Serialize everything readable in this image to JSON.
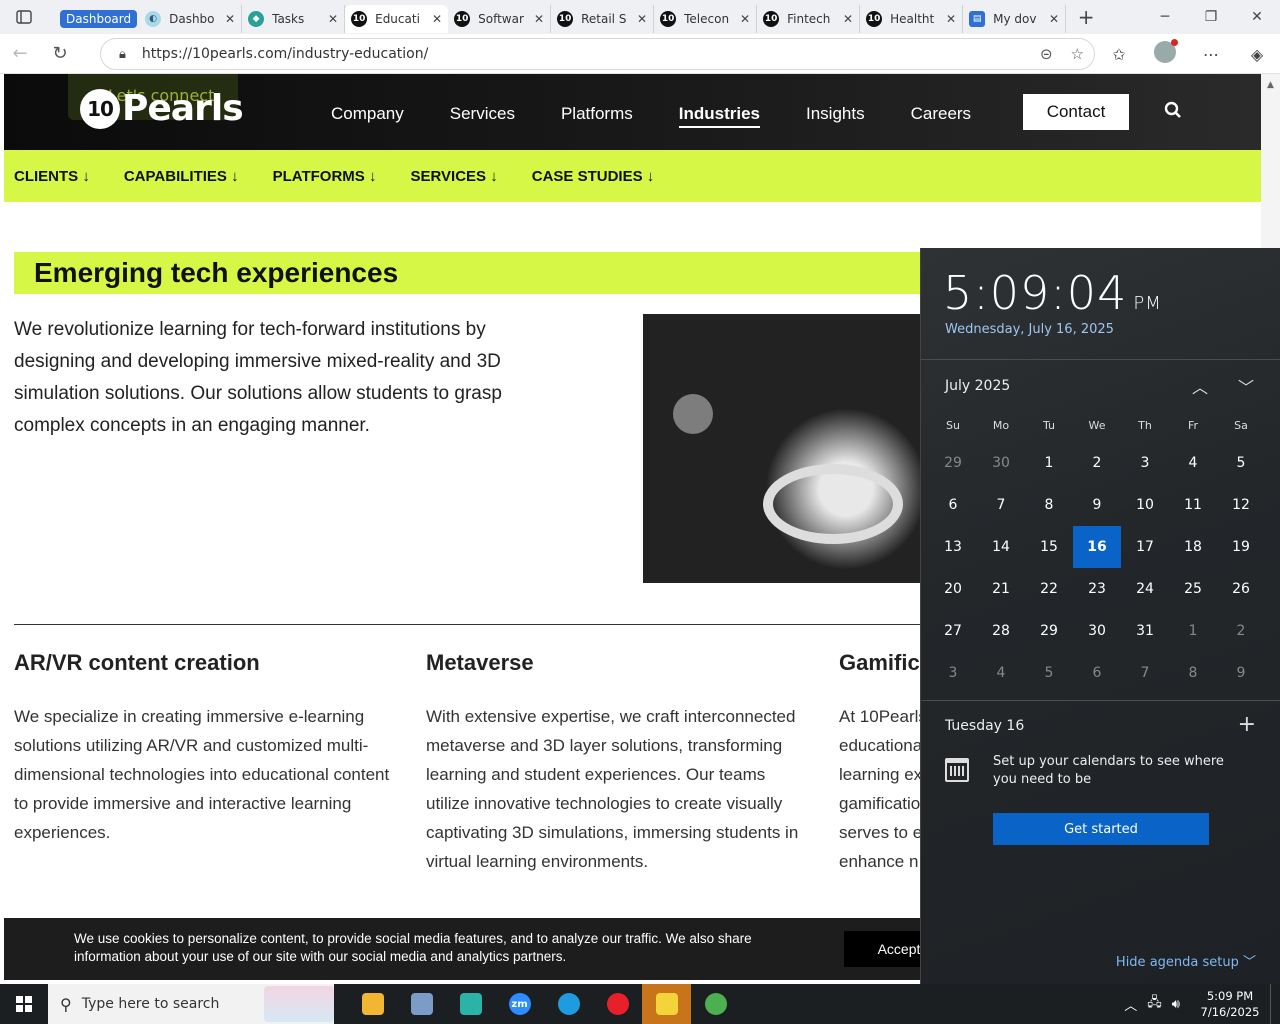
{
  "browser": {
    "group_label": "Dashboard",
    "tabs": [
      {
        "title": "Dashbo",
        "icon": "dashboard-favicon"
      },
      {
        "title": "Tasks",
        "icon": "tasks-favicon"
      },
      {
        "title": "Educati",
        "icon": "10pearls-favicon",
        "active": true
      },
      {
        "title": "Softwar",
        "icon": "10pearls-favicon"
      },
      {
        "title": "Retail S",
        "icon": "10pearls-favicon"
      },
      {
        "title": "Telecon",
        "icon": "10pearls-favicon"
      },
      {
        "title": "Fintech",
        "icon": "10pearls-favicon"
      },
      {
        "title": "Healtht",
        "icon": "10pearls-favicon"
      },
      {
        "title": "My dov",
        "icon": "docs-favicon"
      }
    ],
    "url": "https://10pearls.com/industry-education/"
  },
  "site": {
    "lets_connect": "Let's connect",
    "logo": "Pearls",
    "logo_mark": "10",
    "nav": [
      "Company",
      "Services",
      "Platforms",
      "Industries",
      "Insights",
      "Careers"
    ],
    "nav_active": "Industries",
    "contact": "Contact",
    "subnav": [
      "CLIENTS ↓",
      "CAPABILITIES ↓",
      "PLATFORMS ↓",
      "SERVICES ↓",
      "CASE STUDIES ↓"
    ],
    "section_title": "Emerging tech experiences",
    "intro": "We revolutionize learning for tech-forward institutions by designing and developing immersive mixed-reality and 3D simulation solutions. Our solutions allow students to grasp complex concepts in an engaging manner.",
    "columns": [
      {
        "title": "AR/VR content creation",
        "text": "We specialize in creating immersive e-learning solutions utilizing AR/VR and customized multi-dimensional technologies into educational content to provide immersive and interactive learning experiences."
      },
      {
        "title": "Metaverse",
        "text": "With extensive expertise, we craft interconnected metaverse and 3D layer solutions, transforming learning and student experiences. Our teams utilize innovative technologies to create visually captivating 3D simulations, immersing students in virtual learning environments."
      },
      {
        "title": "Gamific",
        "text": "At 10Pearls educationa learning ex gamificatio serves to e enhance n"
      }
    ],
    "cookie_text": "We use cookies to personalize content, to provide social media features, and to analyze our traffic. We also share information about your use of our site with our social media and analytics partners.",
    "cookie_accept": "Accept"
  },
  "calendar": {
    "time": "5:09:04",
    "ampm": "PM",
    "date": "Wednesday, July 16, 2025",
    "month": "July 2025",
    "weekdays": [
      "Su",
      "Mo",
      "Tu",
      "We",
      "Th",
      "Fr",
      "Sa"
    ],
    "days": [
      {
        "d": "29",
        "dim": true
      },
      {
        "d": "30",
        "dim": true
      },
      {
        "d": "1"
      },
      {
        "d": "2"
      },
      {
        "d": "3"
      },
      {
        "d": "4"
      },
      {
        "d": "5"
      },
      {
        "d": "6"
      },
      {
        "d": "7"
      },
      {
        "d": "8"
      },
      {
        "d": "9"
      },
      {
        "d": "10"
      },
      {
        "d": "11"
      },
      {
        "d": "12"
      },
      {
        "d": "13"
      },
      {
        "d": "14"
      },
      {
        "d": "15"
      },
      {
        "d": "16",
        "today": true
      },
      {
        "d": "17"
      },
      {
        "d": "18"
      },
      {
        "d": "19"
      },
      {
        "d": "20"
      },
      {
        "d": "21"
      },
      {
        "d": "22"
      },
      {
        "d": "23"
      },
      {
        "d": "24"
      },
      {
        "d": "25"
      },
      {
        "d": "26"
      },
      {
        "d": "27"
      },
      {
        "d": "28"
      },
      {
        "d": "29"
      },
      {
        "d": "30"
      },
      {
        "d": "31"
      },
      {
        "d": "1",
        "dim": true
      },
      {
        "d": "2",
        "dim": true
      },
      {
        "d": "3",
        "dim": true
      },
      {
        "d": "4",
        "dim": true
      },
      {
        "d": "5",
        "dim": true
      },
      {
        "d": "6",
        "dim": true
      },
      {
        "d": "7",
        "dim": true
      },
      {
        "d": "8",
        "dim": true
      },
      {
        "d": "9",
        "dim": true
      }
    ],
    "agenda_day": "Tuesday 16",
    "agenda_message": "Set up your calendars to see where you need to be",
    "get_started": "Get started",
    "hide_agenda": "Hide agenda setup"
  },
  "taskbar": {
    "search_placeholder": "Type here to search",
    "apps": [
      {
        "name": "file-explorer",
        "color": "#f2b632"
      },
      {
        "name": "paint-app",
        "color": "#7a9cc6"
      },
      {
        "name": "diamond-app",
        "color": "#2ab3a6"
      },
      {
        "name": "zoom-app",
        "color": "#2d8cff",
        "label": "zm"
      },
      {
        "name": "edge-app",
        "color": "#1f9be0"
      },
      {
        "name": "opera-app",
        "color": "#e8202a"
      },
      {
        "name": "sticky-notes-app",
        "color": "#f5d33a"
      },
      {
        "name": "chrome-app",
        "color": "#4caf50"
      }
    ],
    "time": "5:09 PM",
    "date": "7/16/2025"
  },
  "colors": {
    "accent_lime": "#d7f746",
    "windows_blue": "#0a64c8"
  }
}
